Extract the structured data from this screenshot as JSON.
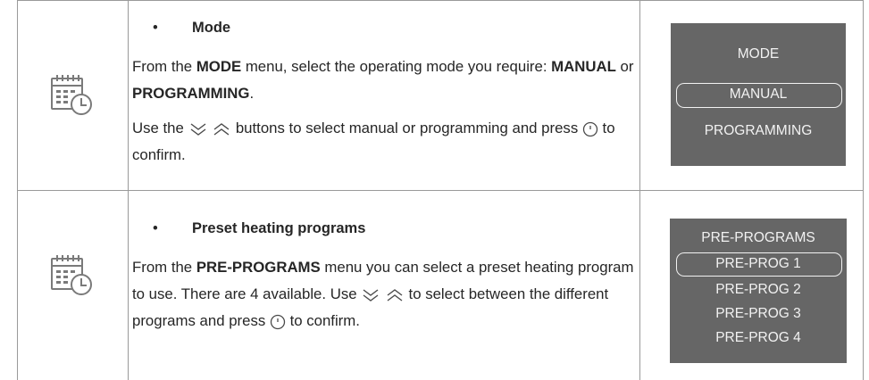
{
  "rows": [
    {
      "bullet": "•",
      "heading": "Mode",
      "para": {
        "t1": "From the ",
        "b1": "MODE",
        "t2": " menu, select the operating mode you require: ",
        "b2": "MANUAL",
        "t3": " or ",
        "b3": "PROGRAMMING",
        "t4": "."
      },
      "para2": {
        "t1": "Use the ",
        "t2": " buttons to select manual or programming and press ",
        "t3": " to confirm."
      },
      "screen": {
        "title": "MODE",
        "items": [
          "MANUAL",
          "PROGRAMMING"
        ],
        "selected": "MANUAL"
      }
    },
    {
      "bullet": "•",
      "heading": "Preset heating programs",
      "para": {
        "t1": "From the ",
        "b1": "PRE-PROGRAMS",
        "t2": " menu you can select a preset heating program to use. There are 4 available. Use ",
        "t3": " to select between the different programs and press ",
        "t4": " to confirm."
      },
      "screen": {
        "title": "PRE-PROGRAMS",
        "items": [
          "PRE-PROG 1",
          "PRE-PROG 2",
          "PRE-PROG 3",
          "PRE-PROG 4"
        ],
        "selected": "PRE-PROG 1"
      }
    }
  ],
  "icons": {
    "row_icon": "calendar-clock-icon",
    "down": "double-chevron-down-icon",
    "up": "double-chevron-up-icon",
    "confirm": "power-confirm-icon"
  },
  "colors": {
    "screen_bg": "#666666",
    "screen_text": "#f2f2f2",
    "border": "#9a9a9a",
    "text": "#262626"
  }
}
